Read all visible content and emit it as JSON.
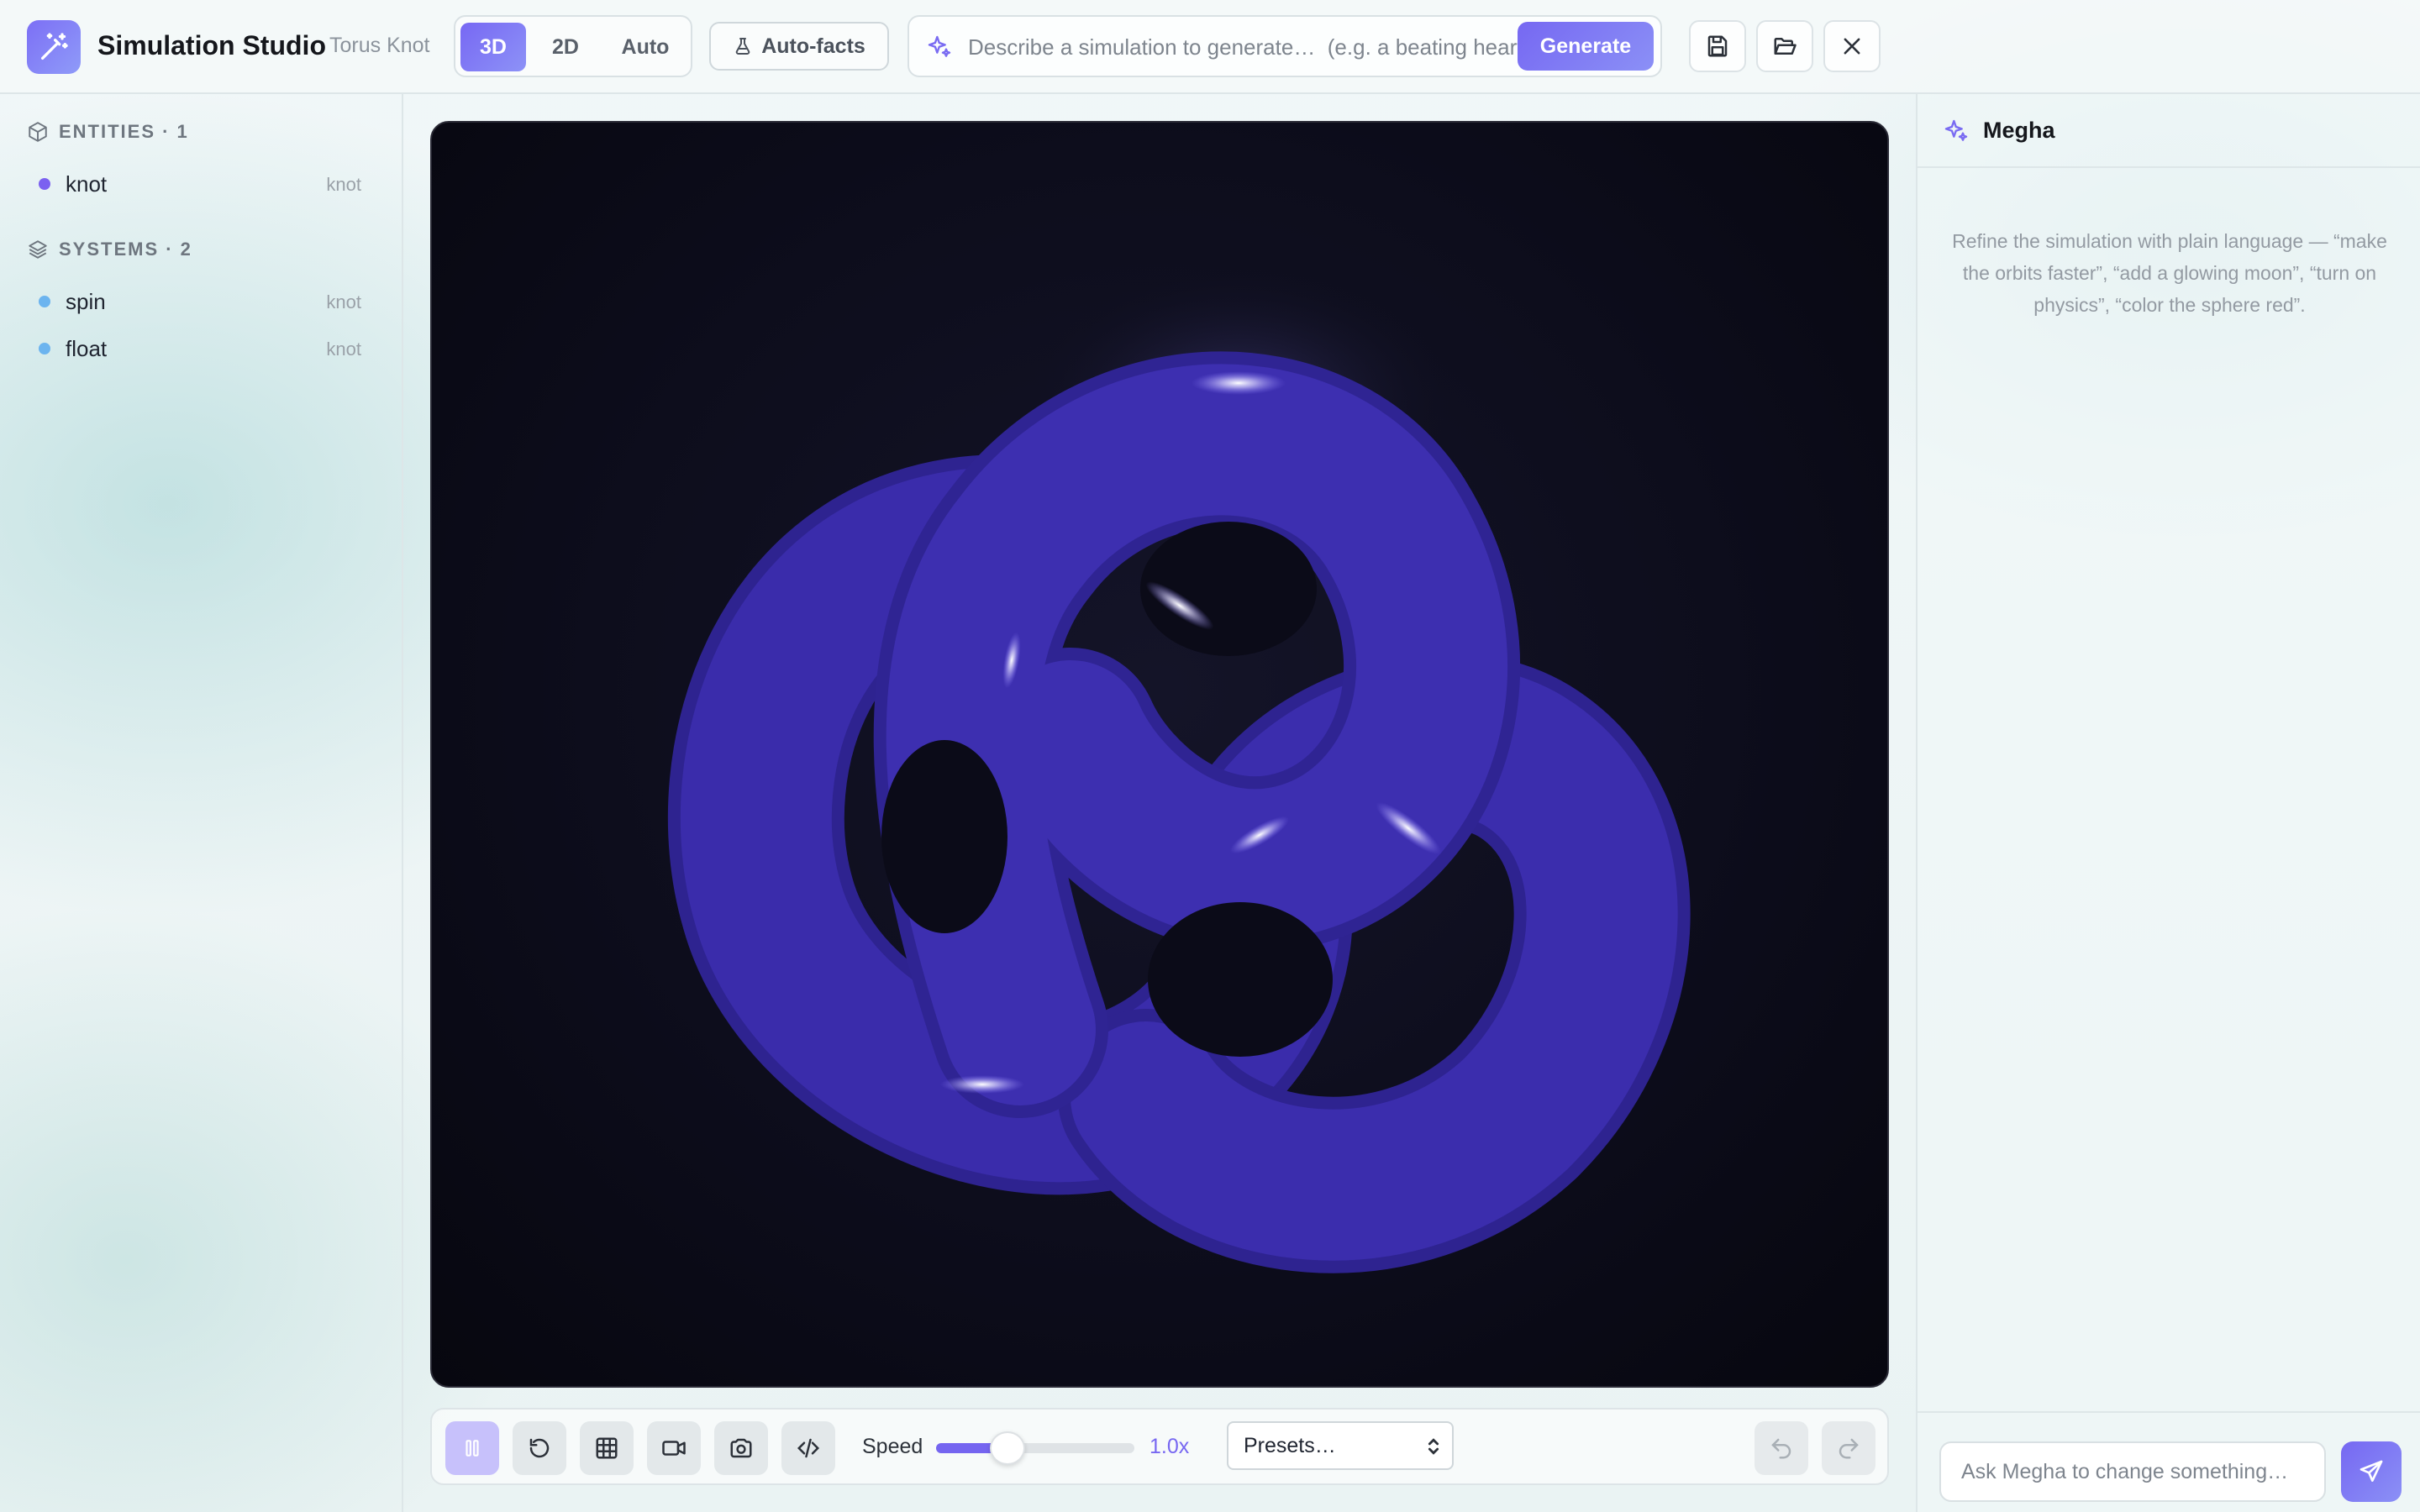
{
  "header": {
    "app_title": "Simulation Studio",
    "project_name": "Torus Knot",
    "modes": [
      {
        "label": "3D",
        "active": true
      },
      {
        "label": "2D",
        "active": false
      },
      {
        "label": "Auto",
        "active": false
      }
    ],
    "autofacts_label": "Auto-facts",
    "prompt_placeholder": "Describe a simulation to generate…  (e.g. a beating heart)",
    "generate_label": "Generate",
    "icons": [
      "wand-icon",
      "flask-icon",
      "sparkle-icon",
      "save-icon",
      "folder-open-icon",
      "close-icon"
    ]
  },
  "sidebar": {
    "entities_heading": "ENTITIES · 1",
    "entities": [
      {
        "label": "knot",
        "tag": "knot",
        "color": "#7b61f0"
      }
    ],
    "systems_heading": "SYSTEMS · 2",
    "systems": [
      {
        "label": "spin",
        "tag": "knot",
        "color": "#6cb4ef"
      },
      {
        "label": "float",
        "tag": "knot",
        "color": "#6cb4ef"
      }
    ]
  },
  "viewport": {
    "object_color": "#3a2aa8",
    "background_color": "#0b0b18"
  },
  "toolbar": {
    "speed_label": "Speed",
    "speed_value": "1.0x",
    "speed_fraction": 0.36,
    "presets_label": "Presets…",
    "icons": [
      "pause-icon",
      "reset-icon",
      "grid-icon",
      "record-icon",
      "camera-icon",
      "code-icon",
      "undo-icon",
      "redo-icon"
    ]
  },
  "assistant": {
    "name": "Megha",
    "hint": "Refine the simulation with plain language — “make the orbits faster”, “add a glowing moon”, “turn on physics”, “color the sphere red”.",
    "input_placeholder": "Ask Megha to change something…"
  },
  "colors": {
    "accent": "#7668f2",
    "accent_light": "#8b90f6"
  }
}
